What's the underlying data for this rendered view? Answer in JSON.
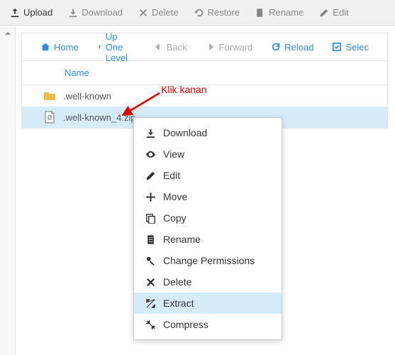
{
  "toolbar": {
    "upload": "Upload",
    "download": "Download",
    "delete": "Delete",
    "restore": "Restore",
    "rename": "Rename",
    "edit": "Edit"
  },
  "nav": {
    "home": "Home",
    "up": "Up One Level",
    "back": "Back",
    "forward": "Forward",
    "reload": "Reload",
    "select": "Selec"
  },
  "columns": {
    "name": "Name"
  },
  "files": {
    "folder": ".well-known",
    "zip": ".well-known_4.zip"
  },
  "contextMenu": {
    "download": "Download",
    "view": "View",
    "edit": "Edit",
    "move": "Move",
    "copy": "Copy",
    "rename": "Rename",
    "permissions": "Change Permissions",
    "delete": "Delete",
    "extract": "Extract",
    "compress": "Compress"
  },
  "annotation": {
    "klik": "Klik kanan"
  }
}
